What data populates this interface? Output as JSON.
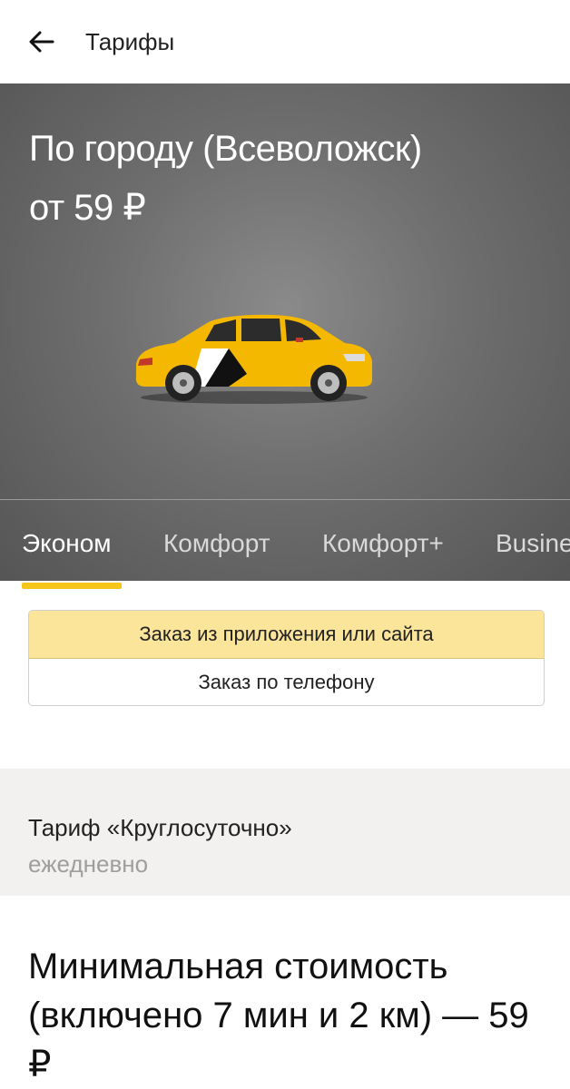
{
  "appbar": {
    "title": "Тарифы",
    "back_icon": "arrow-left-icon"
  },
  "hero": {
    "title": "По городу (Всеволожск)",
    "price": "от 59 ₽",
    "image": "taxi-car-illustration",
    "colors": {
      "car": "#f5b800",
      "accent": "#f5c518"
    }
  },
  "tabs": [
    {
      "label": "Эконом",
      "active": true
    },
    {
      "label": "Комфорт",
      "active": false
    },
    {
      "label": "Комфорт+",
      "active": false
    },
    {
      "label": "Business",
      "active": false
    }
  ],
  "order_type": {
    "options": [
      {
        "label": "Заказ из приложения или сайта",
        "selected": true
      },
      {
        "label": "Заказ по телефону",
        "selected": false
      }
    ]
  },
  "tariff": {
    "name": "Тариф «Круглосуточно»",
    "days": "ежедневно"
  },
  "min_cost": {
    "text": "Минимальная стоимость (включено 7 мин и 2 км) — 59 ₽"
  }
}
